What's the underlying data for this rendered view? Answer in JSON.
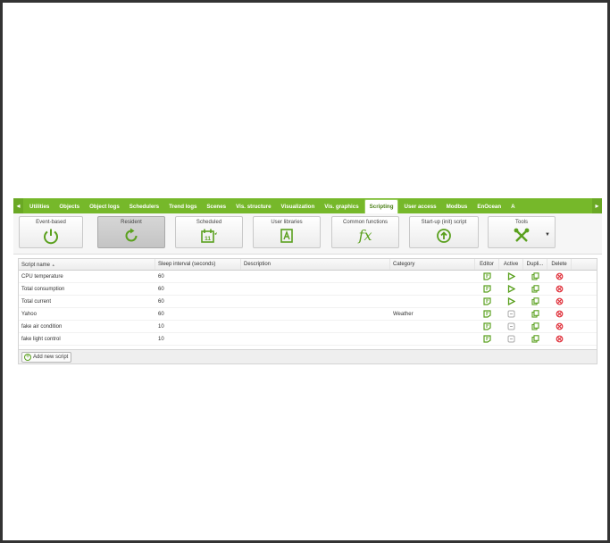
{
  "tabs": {
    "items": [
      "Utilities",
      "Objects",
      "Object logs",
      "Schedulers",
      "Trend logs",
      "Scenes",
      "Vis. structure",
      "Visualization",
      "Vis. graphics",
      "Scripting",
      "User access",
      "Modbus",
      "EnOcean",
      "A"
    ],
    "active": "Scripting"
  },
  "toolbar": {
    "event_based": "Event-based",
    "resident": "Resident",
    "scheduled": "Scheduled",
    "scheduled_day": "11",
    "user_libraries": "User libraries",
    "common_functions": "Common functions",
    "fx": "fx",
    "startup": "Start-up (init) script",
    "tools": "Tools"
  },
  "columns": {
    "name": "Script name",
    "sort": "▲",
    "sleep": "Sleep interval (seconds)",
    "desc": "Description",
    "cat": "Category",
    "editor": "Editor",
    "active": "Active",
    "duplicate": "Dupli...",
    "delete": "Delete"
  },
  "rows": [
    {
      "name": "CPU temperature",
      "sleep": "60",
      "description": "",
      "category": "",
      "active": "play"
    },
    {
      "name": "Total consumption",
      "sleep": "60",
      "description": "",
      "category": "",
      "active": "play"
    },
    {
      "name": "Total current",
      "sleep": "60",
      "description": "",
      "category": "",
      "active": "play"
    },
    {
      "name": "Yahoo",
      "sleep": "60",
      "description": "",
      "category": "Weather",
      "active": "paused"
    },
    {
      "name": "fake air condition",
      "sleep": "10",
      "description": "",
      "category": "",
      "active": "paused"
    },
    {
      "name": "fake light control",
      "sleep": "10",
      "description": "",
      "category": "",
      "active": "paused"
    }
  ],
  "footer": {
    "add_label": "Add new script"
  },
  "colors": {
    "green": "#76b82a",
    "red": "#e0303a"
  }
}
